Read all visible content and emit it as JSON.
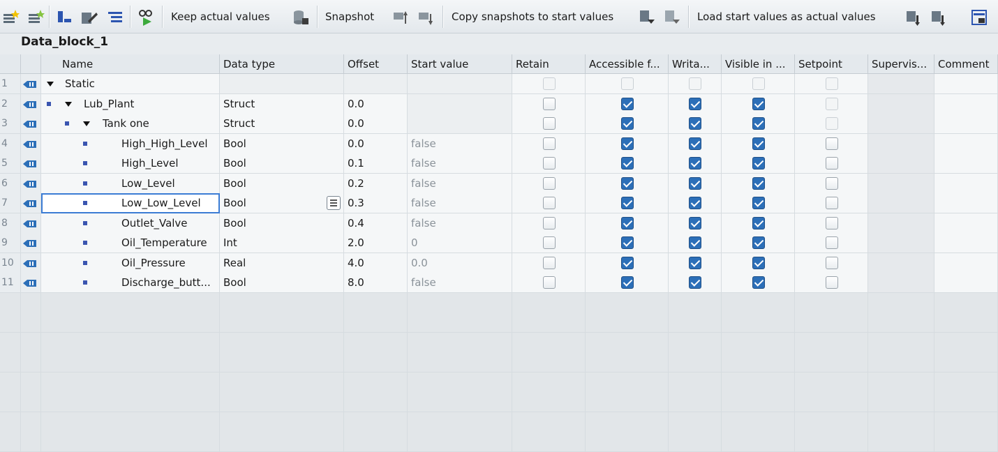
{
  "toolbar": {
    "keep_actual_values": "Keep actual values",
    "snapshot": "Snapshot",
    "copy_snapshots": "Copy snapshots to start values",
    "load_start_values": "Load start values as actual values"
  },
  "block_title": "Data_block_1",
  "columns": {
    "name": "Name",
    "data_type": "Data type",
    "offset": "Offset",
    "start_value": "Start value",
    "retain": "Retain",
    "accessible": "Accessible f...",
    "writable": "Writa...",
    "visible": "Visible in ...",
    "setpoint": "Setpoint",
    "supervision": "Supervis...",
    "comment": "Comment"
  },
  "rows": [
    {
      "num": "1",
      "name": "Static",
      "type": "",
      "offset": "",
      "start": "",
      "retain": false,
      "acc": false,
      "wri": false,
      "vis": false,
      "set": false
    },
    {
      "num": "2",
      "name": "Lub_Plant",
      "type": "Struct",
      "offset": "0.0",
      "start": "",
      "retain": false,
      "acc": true,
      "wri": true,
      "vis": true,
      "set": false
    },
    {
      "num": "3",
      "name": "Tank one",
      "type": "Struct",
      "offset": "0.0",
      "start": "",
      "retain": false,
      "acc": true,
      "wri": true,
      "vis": true,
      "set": false
    },
    {
      "num": "4",
      "name": "High_High_Level",
      "type": "Bool",
      "offset": "0.0",
      "start": "false",
      "retain": false,
      "acc": true,
      "wri": true,
      "vis": true,
      "set": false
    },
    {
      "num": "5",
      "name": "High_Level",
      "type": "Bool",
      "offset": "0.1",
      "start": "false",
      "retain": false,
      "acc": true,
      "wri": true,
      "vis": true,
      "set": false
    },
    {
      "num": "6",
      "name": "Low_Level",
      "type": "Bool",
      "offset": "0.2",
      "start": "false",
      "retain": false,
      "acc": true,
      "wri": true,
      "vis": true,
      "set": false
    },
    {
      "num": "7",
      "name": "Low_Low_Level",
      "type": "Bool",
      "offset": "0.3",
      "start": "false",
      "retain": false,
      "acc": true,
      "wri": true,
      "vis": true,
      "set": false
    },
    {
      "num": "8",
      "name": "Outlet_Valve",
      "type": "Bool",
      "offset": "0.4",
      "start": "false",
      "retain": false,
      "acc": true,
      "wri": true,
      "vis": true,
      "set": false
    },
    {
      "num": "9",
      "name": "Oil_Temperature",
      "type": "Int",
      "offset": "2.0",
      "start": "0",
      "retain": false,
      "acc": true,
      "wri": true,
      "vis": true,
      "set": false
    },
    {
      "num": "10",
      "name": "Oil_Pressure",
      "type": "Real",
      "offset": "4.0",
      "start": "0.0",
      "retain": false,
      "acc": true,
      "wri": true,
      "vis": true,
      "set": false
    },
    {
      "num": "11",
      "name": "Discharge_butt...",
      "type": "Bool",
      "offset": "8.0",
      "start": "false",
      "retain": false,
      "acc": true,
      "wri": true,
      "vis": true,
      "set": false
    }
  ]
}
